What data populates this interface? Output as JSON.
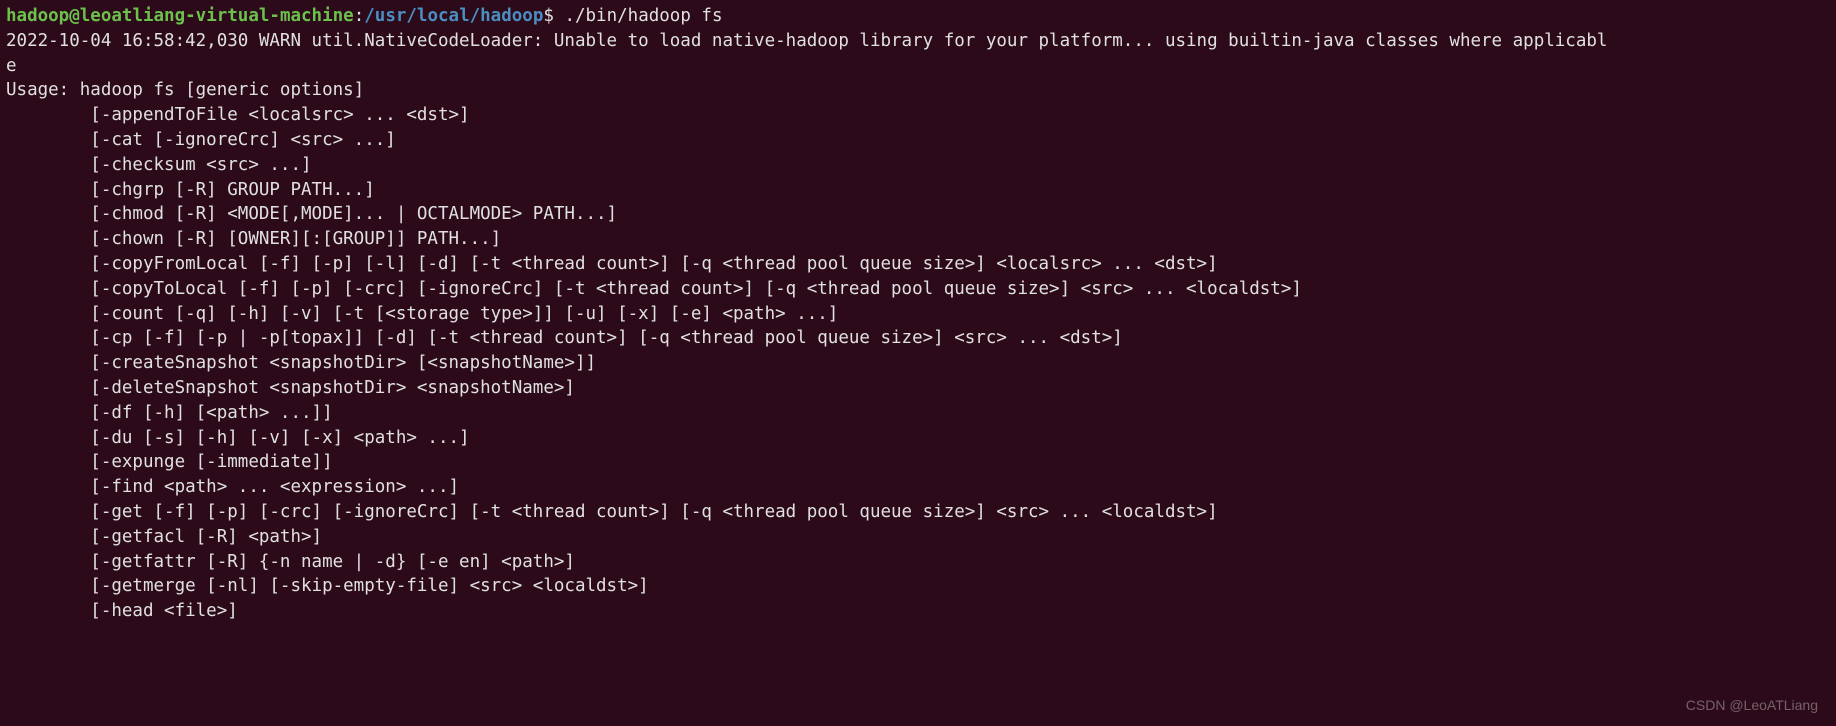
{
  "prompt": {
    "user": "hadoop",
    "at": "@",
    "host": "leoatliang-virtual-machine",
    "colon": ":",
    "path": "/usr/local/hadoop",
    "dollar": "$ ",
    "command": "./bin/hadoop fs"
  },
  "lines": {
    "warn_a": "2022-10-04 16:58:42,030 WARN util.NativeCodeLoader: Unable to load native-hadoop library for your platform... using builtin-java classes where applicabl",
    "warn_b": "e",
    "usage": "Usage: hadoop fs [generic options]",
    "l01": "        [-appendToFile <localsrc> ... <dst>]",
    "l02": "        [-cat [-ignoreCrc] <src> ...]",
    "l03": "        [-checksum <src> ...]",
    "l04": "        [-chgrp [-R] GROUP PATH...]",
    "l05": "        [-chmod [-R] <MODE[,MODE]... | OCTALMODE> PATH...]",
    "l06": "        [-chown [-R] [OWNER][:[GROUP]] PATH...]",
    "l07": "        [-copyFromLocal [-f] [-p] [-l] [-d] [-t <thread count>] [-q <thread pool queue size>] <localsrc> ... <dst>]",
    "l08": "        [-copyToLocal [-f] [-p] [-crc] [-ignoreCrc] [-t <thread count>] [-q <thread pool queue size>] <src> ... <localdst>]",
    "l09": "        [-count [-q] [-h] [-v] [-t [<storage type>]] [-u] [-x] [-e] <path> ...]",
    "l10": "        [-cp [-f] [-p | -p[topax]] [-d] [-t <thread count>] [-q <thread pool queue size>] <src> ... <dst>]",
    "l11": "        [-createSnapshot <snapshotDir> [<snapshotName>]]",
    "l12": "        [-deleteSnapshot <snapshotDir> <snapshotName>]",
    "l13": "        [-df [-h] [<path> ...]]",
    "l14": "        [-du [-s] [-h] [-v] [-x] <path> ...]",
    "l15": "        [-expunge [-immediate]]",
    "l16": "        [-find <path> ... <expression> ...]",
    "l17": "        [-get [-f] [-p] [-crc] [-ignoreCrc] [-t <thread count>] [-q <thread pool queue size>] <src> ... <localdst>]",
    "l18": "        [-getfacl [-R] <path>]",
    "l19": "        [-getfattr [-R] {-n name | -d} [-e en] <path>]",
    "l20": "        [-getmerge [-nl] [-skip-empty-file] <src> <localdst>]",
    "l21": "        [-head <file>]"
  },
  "watermark": "CSDN @LeoATLiang"
}
